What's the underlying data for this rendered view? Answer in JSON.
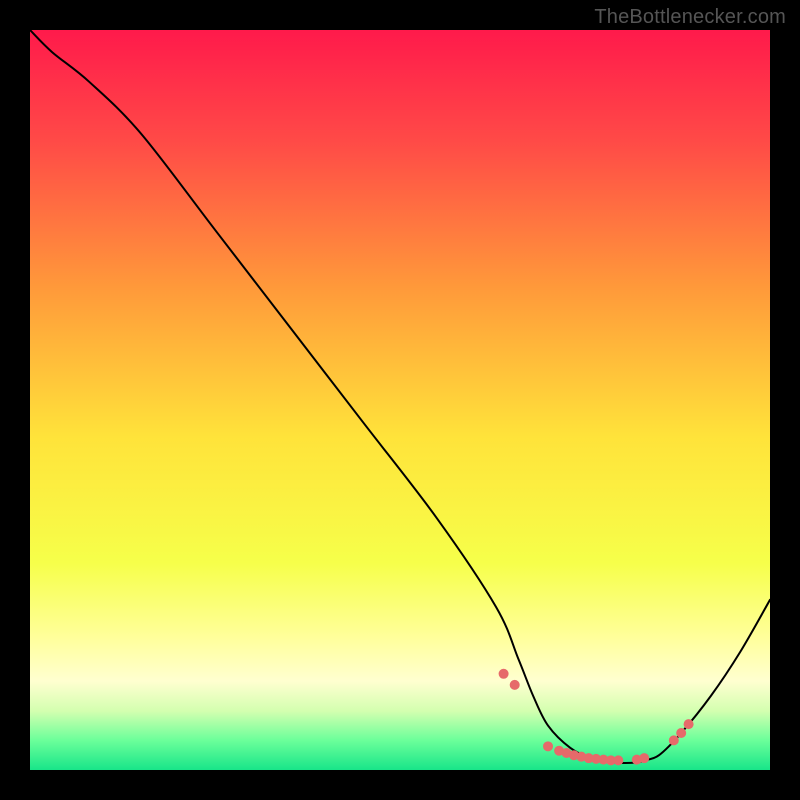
{
  "attribution": "TheBottlenecker.com",
  "chart_data": {
    "type": "line",
    "title": "",
    "xlabel": "",
    "ylabel": "",
    "xlim": [
      0,
      100
    ],
    "ylim": [
      0,
      100
    ],
    "series": [
      {
        "name": "bottleneck-curve",
        "x": [
          0,
          3,
          8,
          15,
          25,
          35,
          45,
          55,
          63,
          66,
          68,
          70,
          73,
          76,
          79,
          82,
          83,
          85,
          88,
          92,
          96,
          100
        ],
        "y": [
          100,
          97,
          93,
          86,
          73,
          60,
          47,
          34,
          22,
          15,
          10,
          6,
          3,
          1.5,
          1,
          1,
          1.3,
          2,
          5,
          10,
          16,
          23
        ]
      }
    ],
    "markers": {
      "name": "highlight-points",
      "color": "#e66a6a",
      "x": [
        64,
        65.5,
        70,
        71.5,
        72.5,
        73.5,
        74.5,
        75.5,
        76.5,
        77.5,
        78.5,
        79.5,
        82,
        83,
        87,
        88,
        89
      ],
      "y": [
        13,
        11.5,
        3.2,
        2.6,
        2.3,
        2.0,
        1.8,
        1.6,
        1.5,
        1.4,
        1.3,
        1.3,
        1.4,
        1.6,
        4.0,
        5.0,
        6.2
      ]
    },
    "background": {
      "type": "vertical-gradient",
      "stops": [
        {
          "pos": 0.0,
          "color": "#ff1a4b"
        },
        {
          "pos": 0.15,
          "color": "#ff4a47"
        },
        {
          "pos": 0.35,
          "color": "#ff9a3a"
        },
        {
          "pos": 0.55,
          "color": "#ffe33a"
        },
        {
          "pos": 0.72,
          "color": "#f6ff4a"
        },
        {
          "pos": 0.82,
          "color": "#ffff9a"
        },
        {
          "pos": 0.88,
          "color": "#ffffd0"
        },
        {
          "pos": 0.92,
          "color": "#d4ffb0"
        },
        {
          "pos": 0.96,
          "color": "#6bff9a"
        },
        {
          "pos": 1.0,
          "color": "#18e589"
        }
      ]
    }
  }
}
